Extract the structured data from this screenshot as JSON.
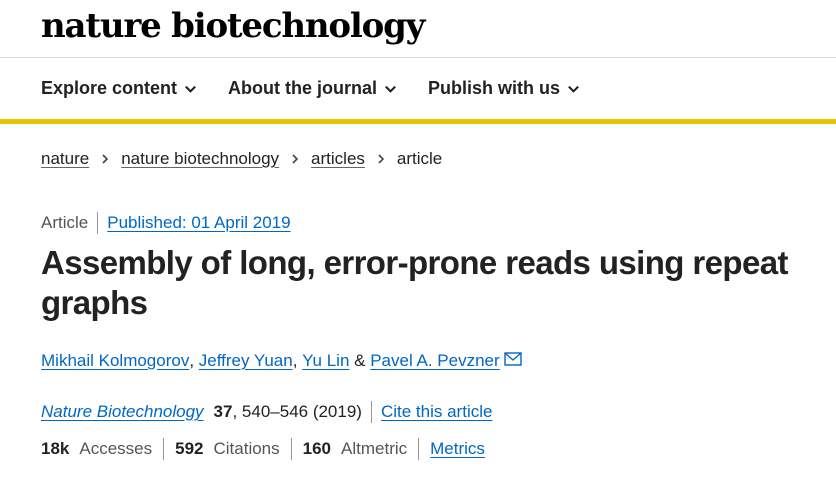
{
  "header": {
    "logo_text": "nature biotechnology"
  },
  "nav": {
    "items": [
      {
        "label": "Explore content",
        "icon": "chevron-down-icon"
      },
      {
        "label": "About the journal",
        "icon": "chevron-down-icon"
      },
      {
        "label": "Publish with us",
        "icon": "chevron-down-icon"
      }
    ]
  },
  "colors": {
    "accent_bar": "#e6c500",
    "link": "#0067c5"
  },
  "breadcrumb": {
    "items": [
      "nature",
      "nature biotechnology",
      "articles"
    ],
    "current": "article"
  },
  "article": {
    "type": "Article",
    "published": "Published: 01 April 2019",
    "title": "Assembly of long, error-prone reads using repeat graphs",
    "authors": [
      "Mikhail Kolmogorov",
      "Jeffrey Yuan",
      "Yu Lin",
      "Pavel A. Pevzner"
    ],
    "author_separators": [
      ", ",
      ", ",
      " & "
    ],
    "citation": {
      "journal": "Nature Biotechnology",
      "volume": "37",
      "pages_year": ", 540–546 (2019)",
      "cite_label": "Cite this article"
    },
    "metrics": {
      "accesses_value": "18k",
      "accesses_label": "Accesses",
      "citations_value": "592",
      "citations_label": "Citations",
      "altmetric_value": "160",
      "altmetric_label": "Altmetric",
      "metrics_link": "Metrics"
    }
  }
}
